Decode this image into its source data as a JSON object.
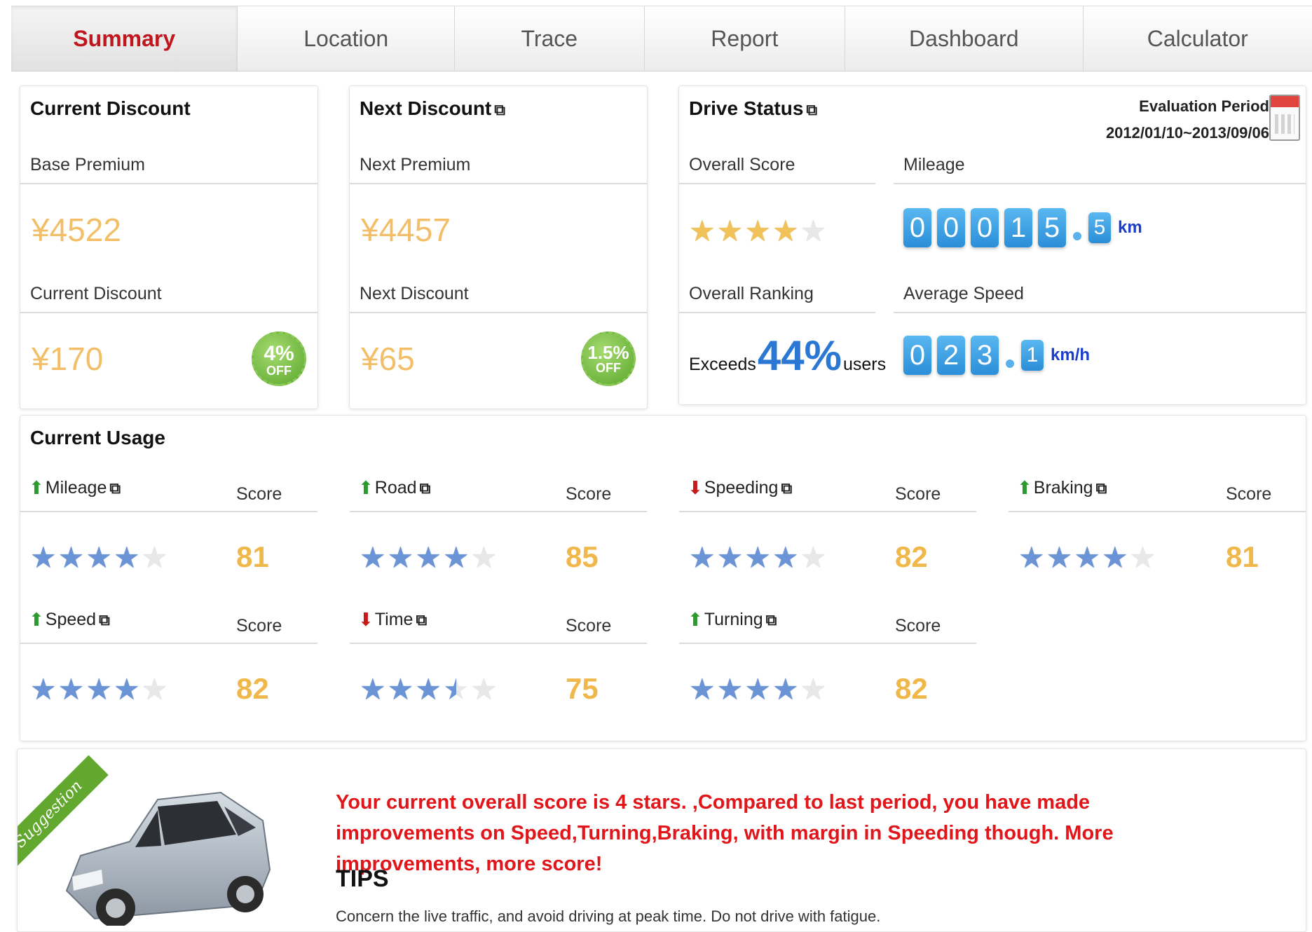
{
  "tabs": [
    {
      "label": "Summary",
      "active": true
    },
    {
      "label": "Location",
      "active": false
    },
    {
      "label": "Trace",
      "active": false
    },
    {
      "label": "Report",
      "active": false
    },
    {
      "label": "Dashboard",
      "active": false
    },
    {
      "label": "Calculator",
      "active": false
    }
  ],
  "current_discount": {
    "title": "Current Discount",
    "premium_label": "Base Premium",
    "premium_value": "¥4522",
    "discount_label": "Current Discount",
    "discount_value": "¥170",
    "badge_pct": "4%",
    "badge_off": "OFF"
  },
  "next_discount": {
    "title": "Next Discount",
    "premium_label": "Next Premium",
    "premium_value": "¥4457",
    "discount_label": "Next Discount",
    "discount_value": "¥65",
    "badge_pct": "1.5%",
    "badge_off": "OFF"
  },
  "drive_status": {
    "title": "Drive Status",
    "evaluation_label": "Evaluation Period",
    "evaluation_dates": "2012/01/10~2013/09/06",
    "overall_score_label": "Overall Score",
    "overall_score_stars": 4,
    "mileage_label": "Mileage",
    "mileage_digits": [
      "0",
      "0",
      "0",
      "1",
      "5"
    ],
    "mileage_decimal": "5",
    "mileage_unit": "km",
    "ranking_label": "Overall Ranking",
    "ranking_prefix": "Exceeds",
    "ranking_value": "44%",
    "ranking_suffix": "users",
    "avg_speed_label": "Average Speed",
    "avg_speed_digits": [
      "0",
      "2",
      "3"
    ],
    "avg_speed_decimal": "1",
    "avg_speed_unit": "km/h"
  },
  "usage": {
    "title": "Current Usage",
    "score_label": "Score",
    "metrics": [
      {
        "name": "Mileage",
        "trend": "up",
        "stars": 4,
        "score": "81"
      },
      {
        "name": "Road",
        "trend": "up",
        "stars": 4,
        "score": "85"
      },
      {
        "name": "Speeding",
        "trend": "down",
        "stars": 4,
        "score": "82"
      },
      {
        "name": "Braking",
        "trend": "up",
        "stars": 4,
        "score": "81"
      },
      {
        "name": "Speed",
        "trend": "up",
        "stars": 4,
        "score": "82"
      },
      {
        "name": "Time",
        "trend": "down",
        "stars": 3.5,
        "score": "75"
      },
      {
        "name": "Turning",
        "trend": "up",
        "stars": 4,
        "score": "82"
      }
    ]
  },
  "suggestion": {
    "ribbon": "Suggestion",
    "message": "Your current overall score is 4 stars. ,Compared to last period, you have made improvements on Speed,Turning,Braking, with margin in Speeding though. More improvements, more score!",
    "tips_title": "TIPS",
    "tips_text": "Concern the live traffic, and avoid driving at peak time. Do not drive with fatigue."
  },
  "icons": {
    "external": "external-link-icon",
    "up": "arrow-up-icon",
    "down": "arrow-down-icon",
    "calendar": "calendar-icon",
    "car": "car-icon"
  },
  "colors": {
    "active_tab": "#c0161d",
    "money": "#f2bf68",
    "score": "#f0b84a",
    "digit": "#2a8ed8",
    "suggestion_text": "#e0161b"
  }
}
